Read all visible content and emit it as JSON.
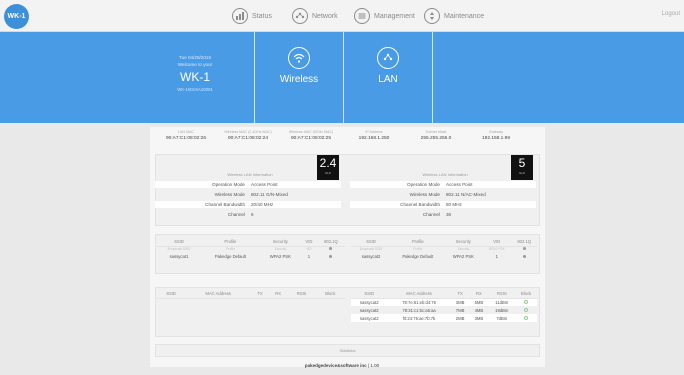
{
  "logo": "WK-1",
  "nav": {
    "status": "Status",
    "network": "Network",
    "management": "Management",
    "maintenance": "Maintenance",
    "logout": "Logout"
  },
  "device": {
    "date": "Tue 04/28/2015",
    "welcome": "Welcome to your",
    "name": "WK-1",
    "serial": "WK-1501SA10001",
    "wireless_label": "Wireless",
    "lan_label": "LAN"
  },
  "stats": [
    {
      "label": "LAN MAC",
      "value": "90:A7:C1:08:02:26"
    },
    {
      "label": "Wireless MAC (2.4GHz MAC)",
      "value": "90:A7:C1:08:02:24"
    },
    {
      "label": "Wireless MAC (5GHz MAC)",
      "value": "90:A7:C1:08:02:25"
    },
    {
      "label": "IP Address",
      "value": "192.168.1.250"
    },
    {
      "label": "Subnet Mask",
      "value": "255.255.255.0"
    },
    {
      "label": "Gateway",
      "value": "192.168.1.99"
    }
  ],
  "wlan24": {
    "badge": "2.4",
    "unit": "GHz",
    "title": "Wireless LAN Information",
    "rows": [
      {
        "label": "Operation Mode",
        "value": "Access Point"
      },
      {
        "label": "Wireless Mode",
        "value": "802.11 G/N-Mixed"
      },
      {
        "label": "Channel Bandwidth",
        "value": "20/40 MHz"
      },
      {
        "label": "Channel",
        "value": "6"
      }
    ]
  },
  "wlan5": {
    "badge": "5",
    "unit": "GHz",
    "title": "Wireless LAN Information",
    "rows": [
      {
        "label": "Operation Mode",
        "value": "Access Point"
      },
      {
        "label": "Wireless Mode",
        "value": "802.11 N/AC-Mixed"
      },
      {
        "label": "Channel Bandwidth",
        "value": "80 MHz"
      },
      {
        "label": "Channel",
        "value": "36"
      }
    ]
  },
  "ssid24": {
    "headers": [
      "SSID",
      "Profile",
      "Security",
      "VID",
      "802.1Q"
    ],
    "sub": [
      "Broadcast SSID",
      "Profile",
      "Security",
      "VID",
      "guest"
    ],
    "row": [
      "sassycat1",
      "Pakedge Default",
      "WPA2 PSK",
      "1"
    ]
  },
  "ssid5": {
    "headers": [
      "SSID",
      "Profile",
      "Security",
      "VID",
      "802.1Q"
    ],
    "sub": [
      "Broadcast SSID",
      "Profile",
      "Security",
      "WPA2 PSK",
      "guest"
    ],
    "row": [
      "sassycat2",
      "Pakedge Default",
      "WPA2 PSK",
      "1"
    ]
  },
  "clients": {
    "headers": [
      "SSID",
      "MAC Address",
      "TX",
      "RX",
      "RSSI",
      "Block"
    ],
    "rows24": [],
    "rows5": [
      {
        "ssid": "sassycat2",
        "mac": "78:7e:61:eb:d4:76",
        "tx": "3MB",
        "rx": "5MB",
        "rssi": "11dBm"
      },
      {
        "ssid": "sassycat2",
        "mac": "78:31:c1:5c:a5:aa",
        "tx": "7MB",
        "rx": "4MB",
        "rssi": "19dBm"
      },
      {
        "ssid": "sassycat2",
        "mac": "f0:24:75:ae:7b:7b",
        "tx": "2MB",
        "rx": "3MB",
        "rssi": "7dBm"
      }
    ]
  },
  "statistics_label": "Statistics",
  "footer": {
    "brand": "pakedgedevice&software inc",
    "version": "| 1.00"
  }
}
